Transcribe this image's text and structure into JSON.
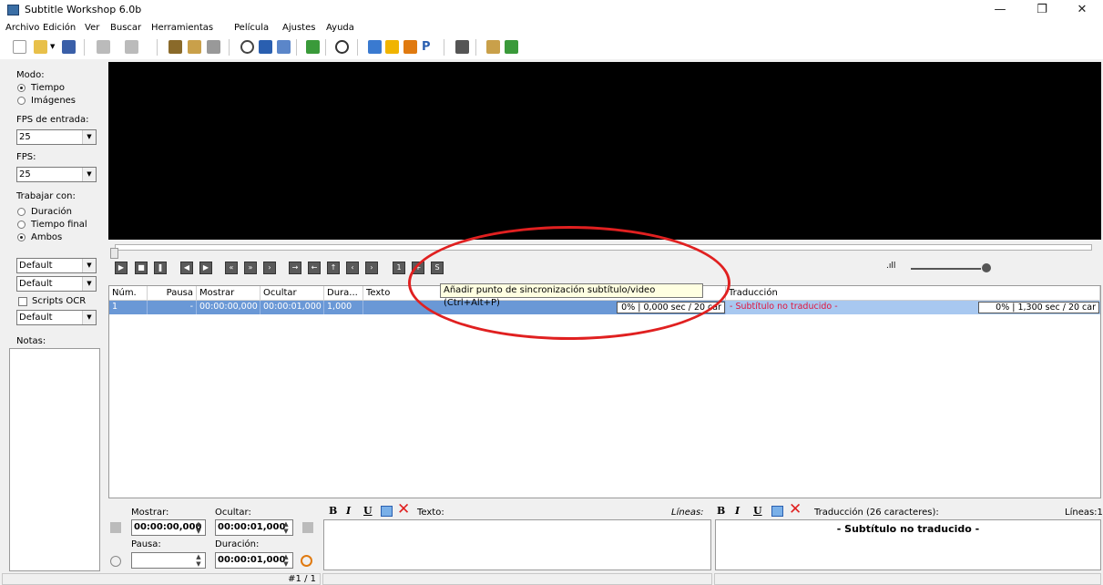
{
  "window": {
    "title": "Subtitle Workshop 6.0b",
    "minimize_icon": "minimize-icon",
    "maximize_icon": "maximize-icon",
    "close_icon": "close-icon"
  },
  "menu": [
    "Archivo",
    "Edición",
    "Ver",
    "Buscar",
    "Herramientas",
    "Película",
    "Ajustes",
    "Ayuda"
  ],
  "left": {
    "mode_label": "Modo:",
    "mode_time": "Tiempo",
    "mode_images": "Imágenes",
    "input_fps_label": "FPS de entrada:",
    "input_fps_value": "25",
    "fps_label": "FPS:",
    "fps_value": "25",
    "work_label": "Trabajar con:",
    "work_duration": "Duración",
    "work_endtime": "Tiempo final",
    "work_both": "Ambos",
    "combo1": "Default",
    "combo2": "Default",
    "scripts_ocr": "Scripts OCR",
    "combo3": "Default",
    "notes_label": "Notas:"
  },
  "grid": {
    "headers": [
      "Núm.",
      "Pausa",
      "Mostrar",
      "Ocultar",
      "Dura...",
      "Texto",
      "Traducción"
    ],
    "row": {
      "num": "1",
      "pause": "-",
      "show": "00:00:00,000",
      "hide": "00:00:01,000",
      "dur": "1,000",
      "text_stat": "0% | 0,000 sec / 20 car",
      "translation": "- Subtítulo no traducido -",
      "trans_stat": "0% | 1,300 sec / 20 car"
    }
  },
  "tooltip": "Añadir punto de sincronización subtítulo/video (Ctrl+Alt+P)",
  "bottom": {
    "show_label": "Mostrar:",
    "hide_label": "Ocultar:",
    "show_value": "00:00:00,000",
    "hide_value": "00:00:01,000",
    "pause_label": "Pausa:",
    "duration_label": "Duración:",
    "duration_value": "00:00:01,000",
    "bold": "B",
    "italic": "I",
    "underline": "U",
    "text_label": "Texto:",
    "lines_label": "Líneas:",
    "trans_label": "Traducción (26 caracteres):",
    "trans_lines_label": "Líneas:1",
    "trans_text": "- Subtítulo no traducido -"
  },
  "status": {
    "count": "#1 / 1"
  },
  "colors": {
    "row_selected": "#6a98d6",
    "untranslated": "#e0143c",
    "annotation": "#e02020"
  }
}
